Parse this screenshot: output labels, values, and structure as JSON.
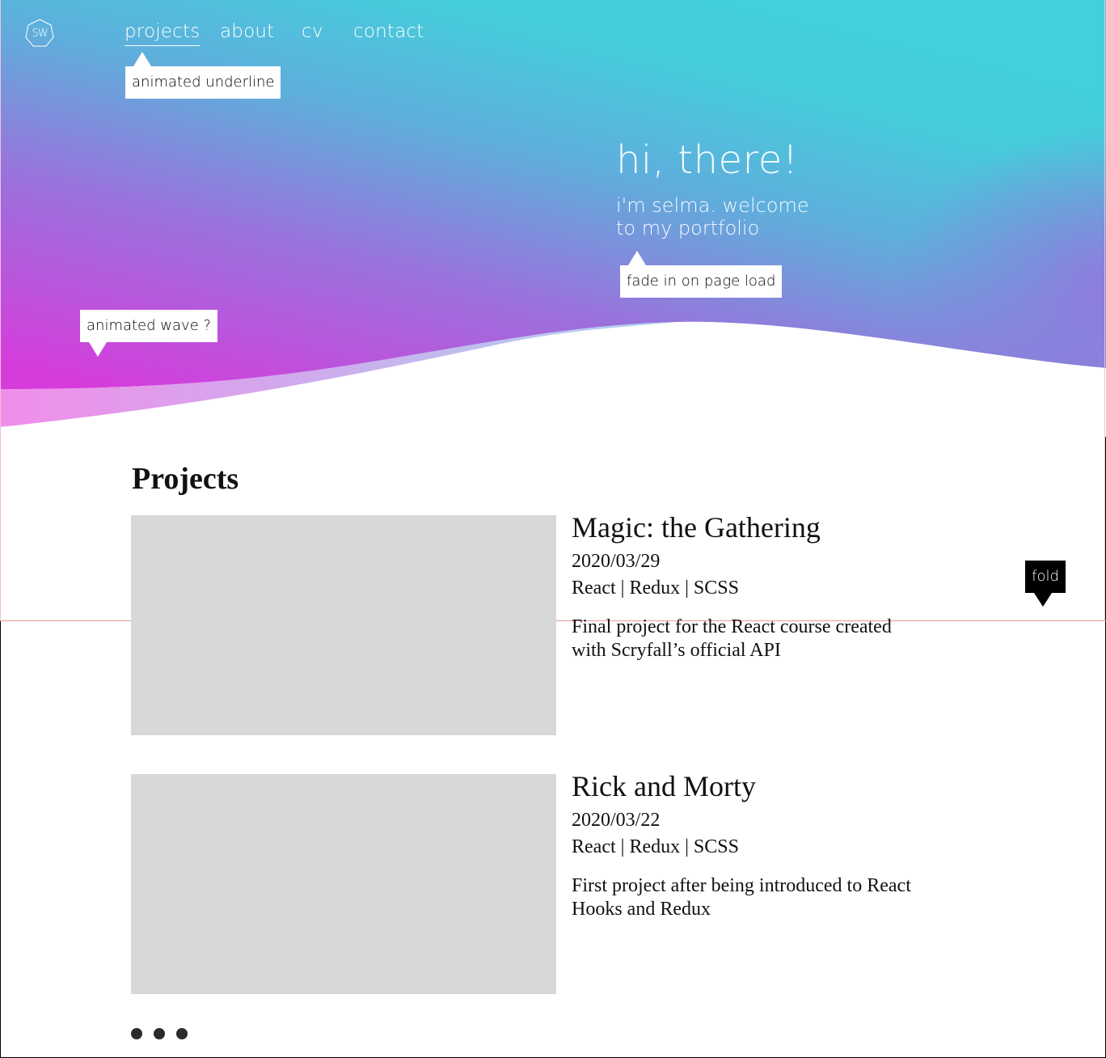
{
  "logo": {
    "text": "SW"
  },
  "nav": {
    "items": [
      {
        "label": "projects",
        "active": true
      },
      {
        "label": "about"
      },
      {
        "label": "cv"
      },
      {
        "label": "contact"
      }
    ]
  },
  "annotations": {
    "underline": "animated underline",
    "fade": "fade in on page load",
    "wave": "animated wave ?",
    "fold": "fold"
  },
  "hero": {
    "title": "hi, there!",
    "subtitle": "i'm selma. welcome to my portfolio"
  },
  "projects_section": {
    "title": "Projects",
    "items": [
      {
        "title": "Magic: the Gathering",
        "date": "2020/03/29",
        "tags": "React | Redux | SCSS",
        "description": "Final project for the React course created with Scryfall’s official API"
      },
      {
        "title": "Rick and Morty",
        "date": "2020/03/22",
        "tags": "React | Redux | SCSS",
        "description": "First project after being introduced to React Hooks and Redux"
      }
    ]
  },
  "pagination": {
    "dots": 3
  },
  "colors": {
    "gradient_teal": "#44d2dc",
    "gradient_blue": "#6fa2dd",
    "gradient_violet": "#9a6fdc",
    "gradient_magenta": "#d23ddc",
    "placeholder_gray": "#d8d8d8"
  }
}
